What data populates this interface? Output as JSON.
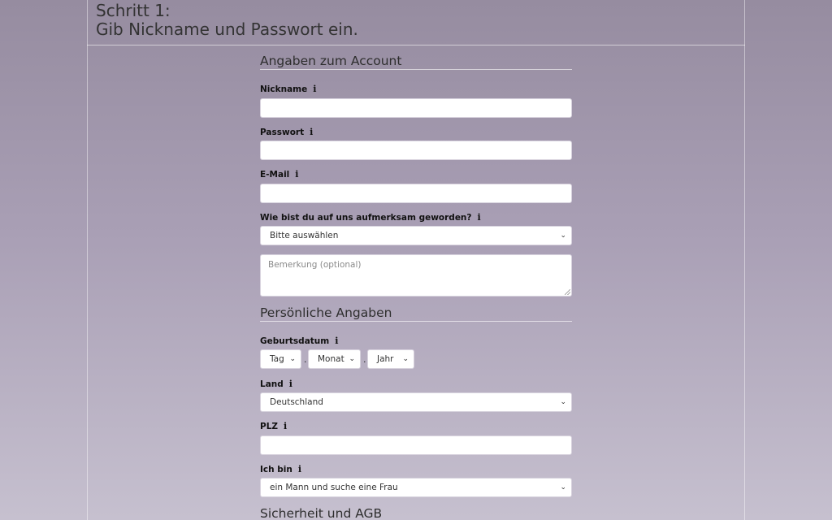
{
  "header": {
    "line1": "Schritt 1:",
    "line2": "Gib Nickname und Passwort ein."
  },
  "sections": {
    "account": "Angaben zum Account",
    "personal": "Persönliche Angaben",
    "security": "Sicherheit und AGB"
  },
  "fields": {
    "nickname": {
      "label": "Nickname",
      "value": ""
    },
    "password": {
      "label": "Passwort",
      "value": ""
    },
    "email": {
      "label": "E-Mail",
      "value": ""
    },
    "referral": {
      "label": "Wie bist du auf uns aufmerksam geworden?",
      "selected": "Bitte auswählen"
    },
    "remark": {
      "placeholder": "Bemerkung (optional)"
    },
    "birthdate": {
      "label": "Geburtsdatum",
      "day": "Tag",
      "month": "Monat",
      "year": "Jahr",
      "separator": "."
    },
    "country": {
      "label": "Land",
      "selected": "Deutschland"
    },
    "zip": {
      "label": "PLZ",
      "value": ""
    },
    "gender": {
      "label": "Ich bin",
      "selected": "ein Mann und suche eine Frau"
    }
  },
  "icons": {
    "info": "info-icon",
    "chevron": "chevron-down-icon"
  },
  "glyphs": {
    "info": "i",
    "chevron": "⌄"
  }
}
